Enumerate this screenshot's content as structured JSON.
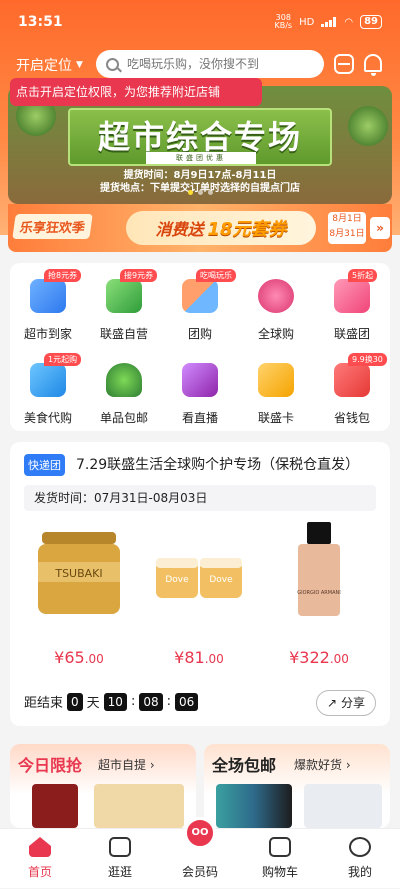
{
  "status_bar": {
    "time": "13:51",
    "net_speed_value": "308",
    "net_speed_unit": "KB/s",
    "network": "HD",
    "battery": "89"
  },
  "header": {
    "location_label": "开启定位",
    "search_placeholder": "吃喝玩乐购，没你搜不到",
    "tooltip": "点击开启定位权限，为您推荐附近店铺"
  },
  "banner": {
    "title": "超市综合专场",
    "subtitle": "联盛团优惠",
    "line1": "提货时间：8月9日17点-8月11日",
    "line2": "提货地点：下单提交订单时选择的自提点门店"
  },
  "promo": {
    "tag": "乐享狂欢季",
    "text_a": "消费送",
    "text_b": "18元套券",
    "date_start": "8月1日",
    "date_end": "8月31日",
    "arrow": "»"
  },
  "categories": [
    {
      "label": "超市到家",
      "badge": "抢8元券",
      "icon": "supermarket-icon",
      "color": "#3d8ef8"
    },
    {
      "label": "联盛自营",
      "badge": "接9元券",
      "icon": "basket-icon",
      "color": "#4caf50"
    },
    {
      "label": "团购",
      "badge": "吃喝玩乐",
      "icon": "groupbuy-icon",
      "color": "#ff7043"
    },
    {
      "label": "全球购",
      "badge": "",
      "icon": "globe-icon",
      "color": "#ec407a"
    },
    {
      "label": "联盛团",
      "badge": "5折起",
      "icon": "bag-icon",
      "color": "#ff5c8a"
    },
    {
      "label": "美食代购",
      "badge": "1元起购",
      "icon": "cart-icon",
      "color": "#2196f3"
    },
    {
      "label": "单品包邮",
      "badge": "",
      "icon": "tree-icon",
      "color": "#43a047"
    },
    {
      "label": "看直播",
      "badge": "",
      "icon": "live-icon",
      "color": "#ab47bc"
    },
    {
      "label": "联盛卡",
      "badge": "",
      "icon": "card-icon",
      "color": "#ffb300"
    },
    {
      "label": "省钱包",
      "badge": "9.9换30",
      "icon": "redpacket-icon",
      "color": "#ff5252"
    }
  ],
  "deal": {
    "tag": "快递团",
    "title": "7.29联盛生活全球购个护专场（保税仓直发）",
    "ship_time": "发货时间：07月31日-08月03日",
    "products": [
      {
        "name": "TSUBAKI",
        "price_int": "¥65",
        "price_dec": ".00"
      },
      {
        "name": "Dove",
        "price_int": "¥81",
        "price_dec": ".00"
      },
      {
        "name": "GIORGIO ARMANI",
        "price_int": "¥322",
        "price_dec": ".00"
      }
    ],
    "countdown_label": "距结束",
    "days": "0",
    "days_unit": "天",
    "hours": "10",
    "minutes": "08",
    "seconds": "06",
    "share_label": "分享"
  },
  "bottom_promos": [
    {
      "title": "今日限抢",
      "subtitle": "超市自提 ›"
    },
    {
      "title": "全场包邮",
      "subtitle": "爆款好货 ›"
    }
  ],
  "tabs": [
    {
      "label": "首页",
      "icon": "home-icon"
    },
    {
      "label": "逛逛",
      "icon": "shopping-bag-icon"
    },
    {
      "label": "会员码",
      "icon": "member-code-icon",
      "badge_text": "OO"
    },
    {
      "label": "购物车",
      "icon": "cart-icon"
    },
    {
      "label": "我的",
      "icon": "profile-icon"
    }
  ]
}
